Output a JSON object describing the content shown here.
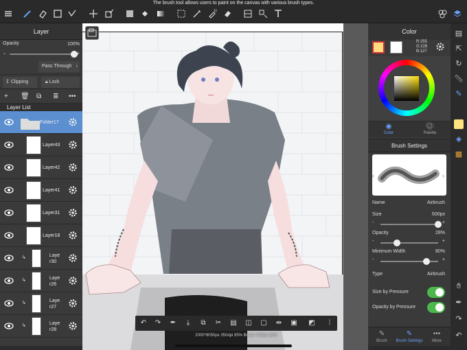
{
  "tooltip": "The brush tool allows users to paint on the canvas with various brush types.",
  "layer_panel": {
    "title": "Layer",
    "opacity_label": "Opacity",
    "opacity_value": "100%",
    "opacity_fraction": 1.0,
    "minus": "-",
    "plus": "+",
    "blend_mode": "Pass Through",
    "clipping_label": "Clipping",
    "lock_label": "Lock",
    "layer_list_label": "Layer List",
    "layers": [
      {
        "name": "Folder17",
        "selected": true
      },
      {
        "name": "Layer43"
      },
      {
        "name": "Layer42"
      },
      {
        "name": "Layer41"
      },
      {
        "name": "Layer31"
      },
      {
        "name": "Layer18"
      },
      {
        "name": "Laye r30"
      },
      {
        "name": "Laye r26"
      },
      {
        "name": "Laye r27"
      },
      {
        "name": "Laye r28"
      }
    ]
  },
  "color_panel": {
    "title": "Color",
    "rgb_r": "R:255",
    "rgb_g": "G:228",
    "rgb_b": "B:127",
    "main_color": "#ffe47f",
    "tab_color": "Color",
    "tab_palette": "Palette"
  },
  "brush_settings": {
    "title": "Brush Settings",
    "name_label": "Name",
    "name_value": "Airbrush",
    "size_label": "Size",
    "size_value": "500px",
    "size_fraction": 1.0,
    "opacity_label": "Opacity",
    "opacity_value": "28%",
    "opacity_fraction": 0.28,
    "min_width_label": "Minimum Width",
    "min_width_value": "80%",
    "min_width_fraction": 0.8,
    "type_label": "Type",
    "type_value": "Airbrush",
    "size_pressure_label": "Size by Pressure",
    "opacity_pressure_label": "Opacity by Pressure",
    "size_pressure_on": true,
    "opacity_pressure_on": true
  },
  "bottom_tabs": {
    "brush": "Brush",
    "brush_settings": "Brush Settings",
    "more": "More"
  },
  "status": "2000*8050px 350dpi 85% Brush: 500px 28%",
  "colors": {
    "accent": "#5b8fd0",
    "toggle_on": "#4cb84c"
  }
}
